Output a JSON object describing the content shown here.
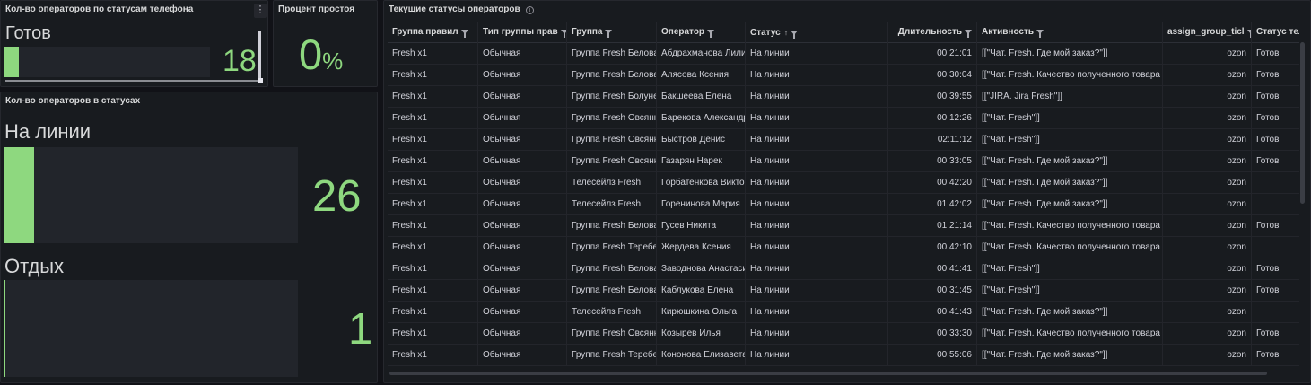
{
  "panel1": {
    "title": "Кол-во операторов по статусам телефона",
    "menu_icon": "⋮",
    "status_label": "Готов",
    "count": "18",
    "bar_fraction": 0.07
  },
  "panel2": {
    "title": "Процент простоя",
    "value": "0",
    "unit": "%"
  },
  "panel3": {
    "title": "Кол-во операторов в статусах",
    "rows": [
      {
        "label": "На линии",
        "count": "26",
        "bar_fraction": 0.1
      },
      {
        "label": "Отдых",
        "count": "1",
        "bar_fraction": 0.004
      }
    ]
  },
  "table_panel": {
    "title": "Текущие статусы операторов",
    "info_icon": "i",
    "headers": [
      "Группа правил",
      "Тип группы прав",
      "Группа",
      "Оператор",
      "Статус",
      "Длительность",
      "Активность",
      "assign_group_ticl",
      "Статус теле"
    ],
    "rows": [
      [
        "Fresh x1",
        "Обычная",
        "Группа Fresh Белова",
        "Абдрахманова Лили",
        "На линии",
        "00:21:01",
        "[[\"Чат. Fresh. Где мой заказ?\"]]",
        "ozon",
        "Готов"
      ],
      [
        "Fresh x1",
        "Обычная",
        "Группа Fresh Белова",
        "Алясова Ксения",
        "На линии",
        "00:30:04",
        "[[\"Чат. Fresh. Качество полученного товара",
        "ozon",
        "Готов"
      ],
      [
        "Fresh x1",
        "Обычная",
        "Группа Fresh Болуне",
        "Бакшеева Елена",
        "На линии",
        "00:39:55",
        "[[\"JIRA. Jira Fresh\"]]",
        "ozon",
        "Готов"
      ],
      [
        "Fresh x1",
        "Обычная",
        "Группа Fresh Овсянн",
        "Барекова Александр",
        "На линии",
        "00:12:26",
        "[[\"Чат. Fresh\"]]",
        "ozon",
        "Готов"
      ],
      [
        "Fresh x1",
        "Обычная",
        "Группа Fresh Овсянн",
        "Быстров Денис",
        "На линии",
        "02:11:12",
        "[[\"Чат. Fresh\"]]",
        "ozon",
        "Готов"
      ],
      [
        "Fresh x1",
        "Обычная",
        "Группа Fresh Овсянн",
        "Газарян Нарек",
        "На линии",
        "00:33:05",
        "[[\"Чат. Fresh. Где мой заказ?\"]]",
        "ozon",
        "Готов"
      ],
      [
        "Fresh x1",
        "Обычная",
        "Телесейлз Fresh",
        "Горбатенкова Виктор",
        "На линии",
        "00:42:20",
        "[[\"Чат. Fresh. Где мой заказ?\"]]",
        "ozon",
        ""
      ],
      [
        "Fresh x1",
        "Обычная",
        "Телесейлз Fresh",
        "Горенинова Мария",
        "На линии",
        "01:42:02",
        "[[\"Чат. Fresh. Где мой заказ?\"]]",
        "ozon",
        ""
      ],
      [
        "Fresh x1",
        "Обычная",
        "Группа Fresh Белова",
        "Гусев Никита",
        "На линии",
        "01:21:14",
        "[[\"Чат. Fresh. Качество полученного товара",
        "ozon",
        "Готов"
      ],
      [
        "Fresh x1",
        "Обычная",
        "Группа Fresh Теребе",
        "Жердева Ксения",
        "На линии",
        "00:42:10",
        "[[\"Чат. Fresh. Качество полученного товара",
        "ozon",
        ""
      ],
      [
        "Fresh x1",
        "Обычная",
        "Группа Fresh Белова",
        "Заводнова Анастаси",
        "На линии",
        "00:41:41",
        "[[\"Чат. Fresh\"]]",
        "ozon",
        "Готов"
      ],
      [
        "Fresh x1",
        "Обычная",
        "Группа Fresh Белова",
        "Каблукова Елена",
        "На линии",
        "00:31:45",
        "[[\"Чат. Fresh\"]]",
        "ozon",
        "Готов"
      ],
      [
        "Fresh x1",
        "Обычная",
        "Телесейлз Fresh",
        "Кирюшкина Ольга",
        "На линии",
        "00:41:43",
        "[[\"Чат. Fresh. Где мой заказ?\"]]",
        "ozon",
        ""
      ],
      [
        "Fresh x1",
        "Обычная",
        "Группа Fresh Овсянн",
        "Козырев Илья",
        "На линии",
        "00:33:30",
        "[[\"Чат. Fresh. Качество полученного товара",
        "ozon",
        "Готов"
      ],
      [
        "Fresh x1",
        "Обычная",
        "Группа Fresh Теребе",
        "Кононова Елизавета",
        "На линии",
        "00:55:06",
        "[[\"Чат. Fresh. Где мой заказ?\"]]",
        "ozon",
        "Готов"
      ]
    ]
  }
}
